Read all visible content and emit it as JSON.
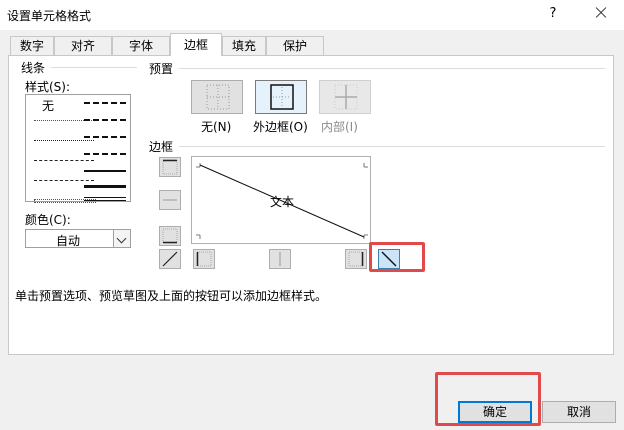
{
  "window": {
    "title": "设置单元格格式",
    "help": "?",
    "close": "close"
  },
  "tabs": [
    {
      "label": "数字"
    },
    {
      "label": "对齐"
    },
    {
      "label": "字体"
    },
    {
      "label": "边框",
      "active": true
    },
    {
      "label": "填充"
    },
    {
      "label": "保护"
    }
  ],
  "line": {
    "section": "线条",
    "style_label": "样式(S):",
    "none": "无",
    "color_label": "颜色(C):",
    "color_value": "自动"
  },
  "presets": {
    "section": "预置",
    "items": [
      {
        "label": "无(N)"
      },
      {
        "label": "外边框(O)",
        "selected": true
      },
      {
        "label": "内部(I)",
        "disabled": true
      }
    ]
  },
  "border": {
    "section": "边框",
    "preview_text": "文本"
  },
  "hint": "单击预置选项、预览草图及上面的按钮可以添加边框样式。",
  "buttons": {
    "ok": "确定",
    "cancel": "取消"
  },
  "colors": {
    "accent": "#0078d7",
    "highlight": "#e04a4a"
  }
}
